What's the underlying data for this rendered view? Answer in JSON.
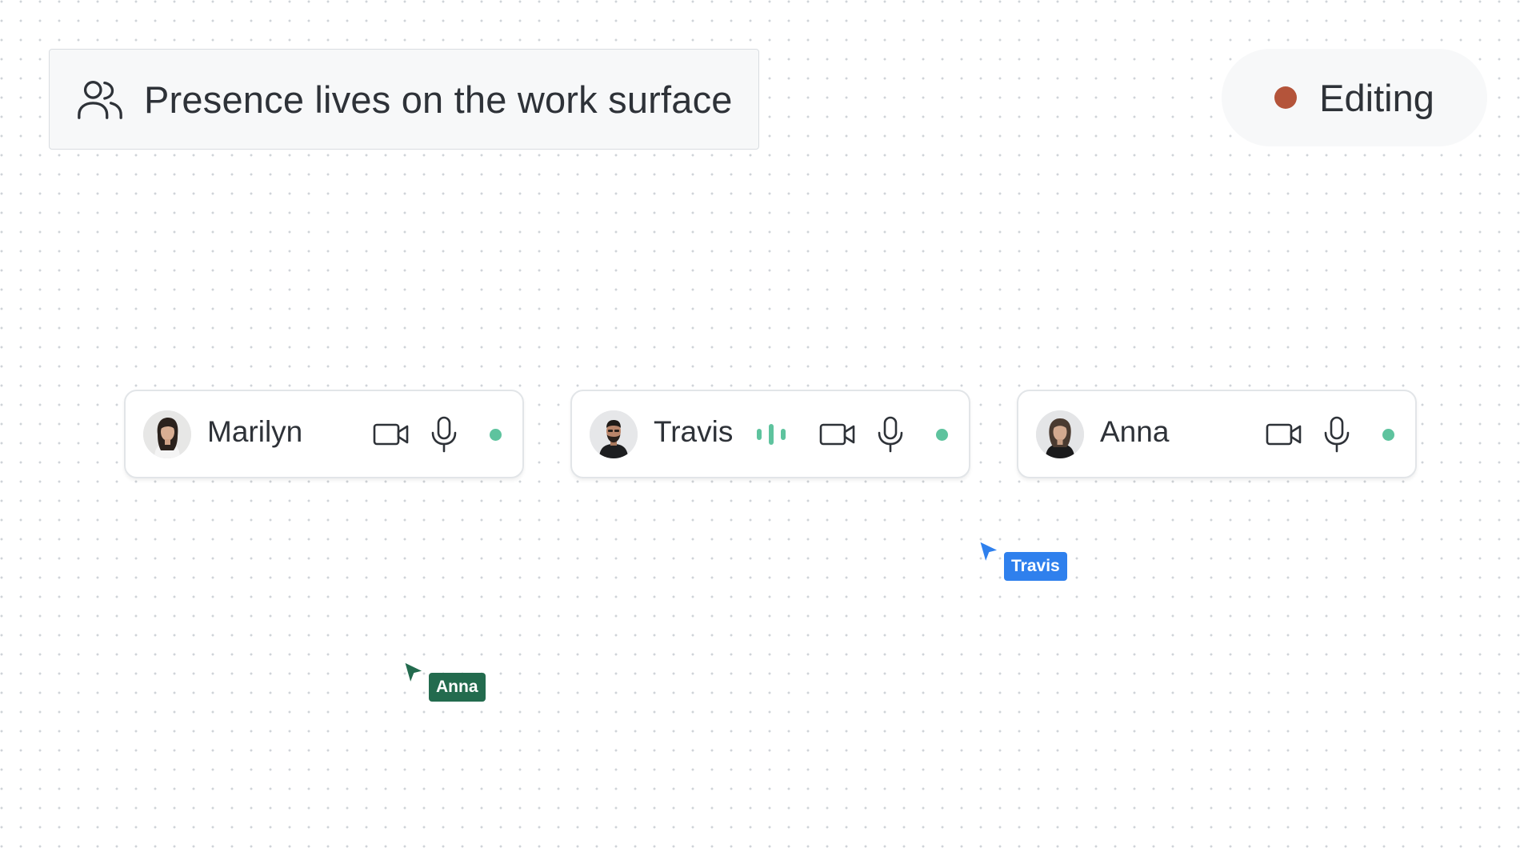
{
  "header": {
    "title": "Presence lives on the work surface",
    "icon": "users-icon"
  },
  "status": {
    "label": "Editing",
    "dot_color": "#b4543a"
  },
  "participants": [
    {
      "name": "Marilyn",
      "avatar": "avatar-marilyn",
      "speaking": false,
      "online_color": "#5ec39e"
    },
    {
      "name": "Travis",
      "avatar": "avatar-travis",
      "speaking": true,
      "online_color": "#5ec39e"
    },
    {
      "name": "Anna",
      "avatar": "avatar-anna",
      "speaking": false,
      "online_color": "#5ec39e"
    }
  ],
  "cursors": [
    {
      "name": "Travis",
      "color": "#2f80ed"
    },
    {
      "name": "Anna",
      "color": "#236b4e"
    }
  ],
  "colors": {
    "speaking": "#5ec39e",
    "icon_stroke": "#2e3238"
  }
}
